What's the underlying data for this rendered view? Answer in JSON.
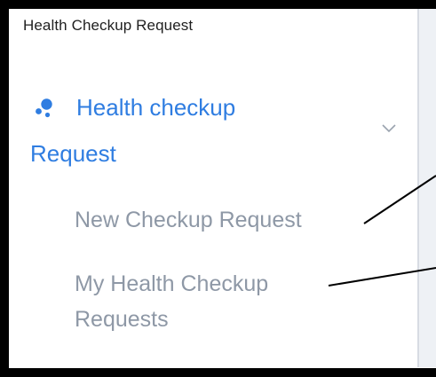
{
  "panel": {
    "title": "Health Checkup Request"
  },
  "nav_group": {
    "label_line1": "Health checkup",
    "label_line2": "Request",
    "icon": "health-dots-icon",
    "expanded": true,
    "accent_color": "#2f7de1"
  },
  "sub_items": [
    {
      "label": "New Checkup Request"
    },
    {
      "label_line1": "My Health Checkup",
      "label_line2": "Requests"
    }
  ],
  "colors": {
    "border": "#000000",
    "submenu_text": "#8e98a6",
    "title_text": "#1f1f1f"
  }
}
